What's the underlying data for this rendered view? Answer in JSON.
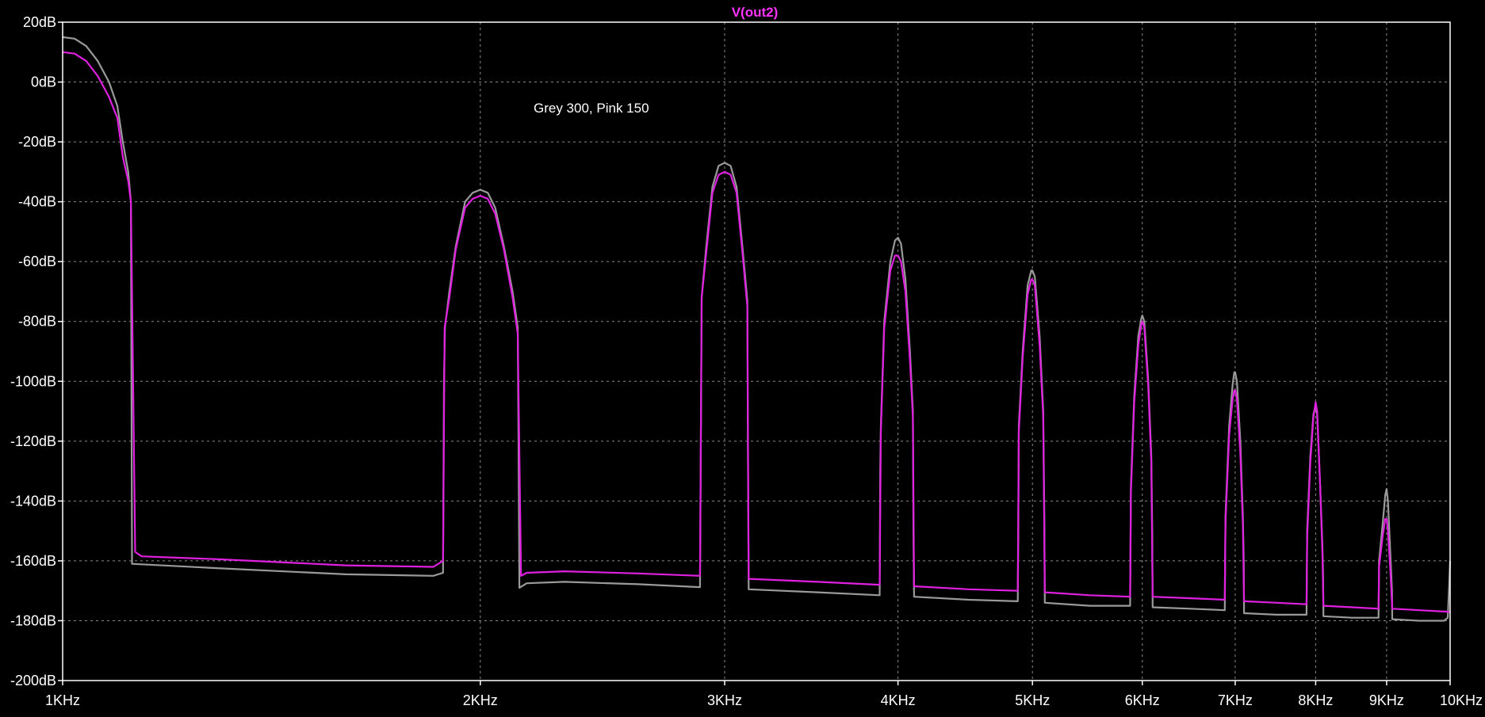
{
  "chart_data": {
    "type": "line",
    "title": "V(out2)",
    "annotation": "Grey 300, Pink 150",
    "x_scale": "log",
    "xlim": [
      1000,
      10000
    ],
    "ylim": [
      -200,
      20
    ],
    "grid": true,
    "x_ticks": [
      {
        "value": 1000,
        "label": "1KHz"
      },
      {
        "value": 2000,
        "label": "2KHz"
      },
      {
        "value": 3000,
        "label": "3KHz"
      },
      {
        "value": 4000,
        "label": "4KHz"
      },
      {
        "value": 5000,
        "label": "5KHz"
      },
      {
        "value": 6000,
        "label": "6KHz"
      },
      {
        "value": 7000,
        "label": "7KHz"
      },
      {
        "value": 8000,
        "label": "8KHz"
      },
      {
        "value": 9000,
        "label": "9KHz"
      },
      {
        "value": 10000,
        "label": "10KHz"
      }
    ],
    "y_ticks": [
      {
        "value": 20,
        "label": "20dB"
      },
      {
        "value": 0,
        "label": "0dB"
      },
      {
        "value": -20,
        "label": "-20dB"
      },
      {
        "value": -40,
        "label": "-40dB"
      },
      {
        "value": -60,
        "label": "-60dB"
      },
      {
        "value": -80,
        "label": "-80dB"
      },
      {
        "value": -100,
        "label": "-100dB"
      },
      {
        "value": -120,
        "label": "-120dB"
      },
      {
        "value": -140,
        "label": "-140dB"
      },
      {
        "value": -160,
        "label": "-160dB"
      },
      {
        "value": -180,
        "label": "-180dB"
      },
      {
        "value": -200,
        "label": "-200dB"
      }
    ],
    "colors": {
      "background": "#000000",
      "frame": "#ffffff",
      "grid": "#8a8a8a",
      "tick_label": "#ffffff",
      "title": "#ff33ff",
      "annotation": "#ffffff"
    },
    "series": [
      {
        "color": "#9a9a9a",
        "points": [
          [
            1000,
            15
          ],
          [
            1020,
            14.5
          ],
          [
            1040,
            12
          ],
          [
            1060,
            7
          ],
          [
            1080,
            0
          ],
          [
            1095,
            -8
          ],
          [
            1105,
            -20
          ],
          [
            1115,
            -30
          ],
          [
            1120,
            -40
          ],
          [
            1121,
            -100
          ],
          [
            1122,
            -161
          ],
          [
            1300,
            -162.5
          ],
          [
            1600,
            -164.5
          ],
          [
            1850,
            -165
          ],
          [
            1880,
            -164
          ],
          [
            1883,
            -100
          ],
          [
            1886,
            -82
          ],
          [
            1900,
            -70
          ],
          [
            1920,
            -55
          ],
          [
            1950,
            -40
          ],
          [
            1975,
            -37
          ],
          [
            2000,
            -36
          ],
          [
            2025,
            -37
          ],
          [
            2050,
            -42
          ],
          [
            2080,
            -55
          ],
          [
            2110,
            -70
          ],
          [
            2128,
            -82
          ],
          [
            2131,
            -120
          ],
          [
            2134,
            -169
          ],
          [
            2160,
            -167.5
          ],
          [
            2300,
            -167
          ],
          [
            2600,
            -167.8
          ],
          [
            2880,
            -168.8
          ],
          [
            2884,
            -120
          ],
          [
            2888,
            -72
          ],
          [
            2910,
            -55
          ],
          [
            2940,
            -35
          ],
          [
            2970,
            -28
          ],
          [
            3000,
            -27
          ],
          [
            3030,
            -28
          ],
          [
            3060,
            -35
          ],
          [
            3090,
            -55
          ],
          [
            3115,
            -73
          ],
          [
            3118,
            -120
          ],
          [
            3122,
            -169.5
          ],
          [
            3500,
            -170.5
          ],
          [
            3880,
            -171.5
          ],
          [
            3884,
            -130
          ],
          [
            3888,
            -115
          ],
          [
            3910,
            -80
          ],
          [
            3950,
            -60
          ],
          [
            3980,
            -53
          ],
          [
            4000,
            -52
          ],
          [
            4020,
            -54
          ],
          [
            4050,
            -66
          ],
          [
            4080,
            -90
          ],
          [
            4100,
            -110
          ],
          [
            4104,
            -150
          ],
          [
            4108,
            -172
          ],
          [
            4500,
            -173
          ],
          [
            4880,
            -173.5
          ],
          [
            4884,
            -150
          ],
          [
            4888,
            -115
          ],
          [
            4920,
            -90
          ],
          [
            4960,
            -68
          ],
          [
            4990,
            -63
          ],
          [
            5000,
            -63
          ],
          [
            5020,
            -65
          ],
          [
            5060,
            -85
          ],
          [
            5090,
            -110
          ],
          [
            5100,
            -145
          ],
          [
            5104,
            -174
          ],
          [
            5500,
            -175
          ],
          [
            5880,
            -175
          ],
          [
            5884,
            -155
          ],
          [
            5888,
            -135
          ],
          [
            5920,
            -105
          ],
          [
            5960,
            -85
          ],
          [
            5990,
            -79
          ],
          [
            6000,
            -78
          ],
          [
            6020,
            -80
          ],
          [
            6060,
            -100
          ],
          [
            6090,
            -125
          ],
          [
            6100,
            -150
          ],
          [
            6104,
            -175.5
          ],
          [
            6500,
            -176
          ],
          [
            6880,
            -176.5
          ],
          [
            6884,
            -160
          ],
          [
            6888,
            -145
          ],
          [
            6930,
            -115
          ],
          [
            6970,
            -101
          ],
          [
            6990,
            -97
          ],
          [
            7000,
            -97
          ],
          [
            7020,
            -100
          ],
          [
            7060,
            -120
          ],
          [
            7090,
            -145
          ],
          [
            7100,
            -160
          ],
          [
            7104,
            -177.5
          ],
          [
            7500,
            -178
          ],
          [
            7880,
            -178
          ],
          [
            7884,
            -165
          ],
          [
            7888,
            -150
          ],
          [
            7930,
            -125
          ],
          [
            7970,
            -111
          ],
          [
            8000,
            -108
          ],
          [
            8020,
            -111
          ],
          [
            8060,
            -135
          ],
          [
            8090,
            -155
          ],
          [
            8100,
            -165
          ],
          [
            8104,
            -178.5
          ],
          [
            8500,
            -179
          ],
          [
            8880,
            -179
          ],
          [
            8884,
            -170
          ],
          [
            8888,
            -160
          ],
          [
            8940,
            -148
          ],
          [
            8980,
            -138
          ],
          [
            9000,
            -136
          ],
          [
            9020,
            -140
          ],
          [
            9060,
            -160
          ],
          [
            9080,
            -170
          ],
          [
            9084,
            -179.5
          ],
          [
            9500,
            -180
          ],
          [
            9900,
            -180
          ],
          [
            9960,
            -179
          ],
          [
            9980,
            -170
          ],
          [
            10000,
            -160
          ]
        ]
      },
      {
        "color": "#e020e0",
        "points": [
          [
            1000,
            10
          ],
          [
            1020,
            9.5
          ],
          [
            1040,
            7
          ],
          [
            1060,
            2
          ],
          [
            1080,
            -5
          ],
          [
            1095,
            -12
          ],
          [
            1105,
            -25
          ],
          [
            1115,
            -33
          ],
          [
            1120,
            -40
          ],
          [
            1128,
            -157
          ],
          [
            1140,
            -158.5
          ],
          [
            1300,
            -159.5
          ],
          [
            1600,
            -161.5
          ],
          [
            1850,
            -162
          ],
          [
            1880,
            -160
          ],
          [
            1885,
            -82
          ],
          [
            1900,
            -72
          ],
          [
            1920,
            -56
          ],
          [
            1950,
            -42
          ],
          [
            1975,
            -39
          ],
          [
            2000,
            -38
          ],
          [
            2025,
            -39
          ],
          [
            2050,
            -44
          ],
          [
            2080,
            -56
          ],
          [
            2110,
            -72
          ],
          [
            2128,
            -84
          ],
          [
            2140,
            -165
          ],
          [
            2160,
            -164
          ],
          [
            2300,
            -163.5
          ],
          [
            2600,
            -164.2
          ],
          [
            2880,
            -165
          ],
          [
            2888,
            -72
          ],
          [
            2910,
            -57
          ],
          [
            2940,
            -37
          ],
          [
            2970,
            -31
          ],
          [
            3000,
            -30
          ],
          [
            3030,
            -31
          ],
          [
            3060,
            -37
          ],
          [
            3090,
            -57
          ],
          [
            3115,
            -75
          ],
          [
            3122,
            -166
          ],
          [
            3500,
            -167
          ],
          [
            3880,
            -168
          ],
          [
            3888,
            -117
          ],
          [
            3910,
            -82
          ],
          [
            3950,
            -63
          ],
          [
            3980,
            -58
          ],
          [
            4000,
            -58
          ],
          [
            4020,
            -60
          ],
          [
            4050,
            -70
          ],
          [
            4080,
            -93
          ],
          [
            4100,
            -112
          ],
          [
            4108,
            -168.5
          ],
          [
            4500,
            -169.5
          ],
          [
            4880,
            -170
          ],
          [
            4888,
            -117
          ],
          [
            4920,
            -92
          ],
          [
            4960,
            -71
          ],
          [
            4990,
            -66
          ],
          [
            5000,
            -66
          ],
          [
            5020,
            -68
          ],
          [
            5060,
            -88
          ],
          [
            5090,
            -112
          ],
          [
            5104,
            -170.5
          ],
          [
            5500,
            -171.5
          ],
          [
            5880,
            -172
          ],
          [
            5888,
            -137
          ],
          [
            5920,
            -107
          ],
          [
            5960,
            -88
          ],
          [
            5990,
            -81
          ],
          [
            6000,
            -80
          ],
          [
            6020,
            -82
          ],
          [
            6060,
            -102
          ],
          [
            6090,
            -127
          ],
          [
            6104,
            -172
          ],
          [
            6500,
            -172.5
          ],
          [
            6880,
            -173
          ],
          [
            6888,
            -147
          ],
          [
            6930,
            -118
          ],
          [
            6970,
            -106
          ],
          [
            6990,
            -103
          ],
          [
            7000,
            -103
          ],
          [
            7020,
            -106
          ],
          [
            7060,
            -124
          ],
          [
            7090,
            -148
          ],
          [
            7104,
            -173.5
          ],
          [
            7500,
            -174
          ],
          [
            7880,
            -174.5
          ],
          [
            7888,
            -152
          ],
          [
            7930,
            -127
          ],
          [
            7970,
            -112
          ],
          [
            8000,
            -107
          ],
          [
            8020,
            -110
          ],
          [
            8060,
            -135
          ],
          [
            8090,
            -157
          ],
          [
            8104,
            -175
          ],
          [
            8500,
            -175.5
          ],
          [
            8880,
            -176
          ],
          [
            8888,
            -162
          ],
          [
            8940,
            -152
          ],
          [
            8980,
            -146
          ],
          [
            9000,
            -146
          ],
          [
            9020,
            -150
          ],
          [
            9060,
            -165
          ],
          [
            9084,
            -176
          ],
          [
            9500,
            -176.5
          ],
          [
            9960,
            -177
          ],
          [
            10000,
            -177
          ]
        ]
      }
    ]
  }
}
